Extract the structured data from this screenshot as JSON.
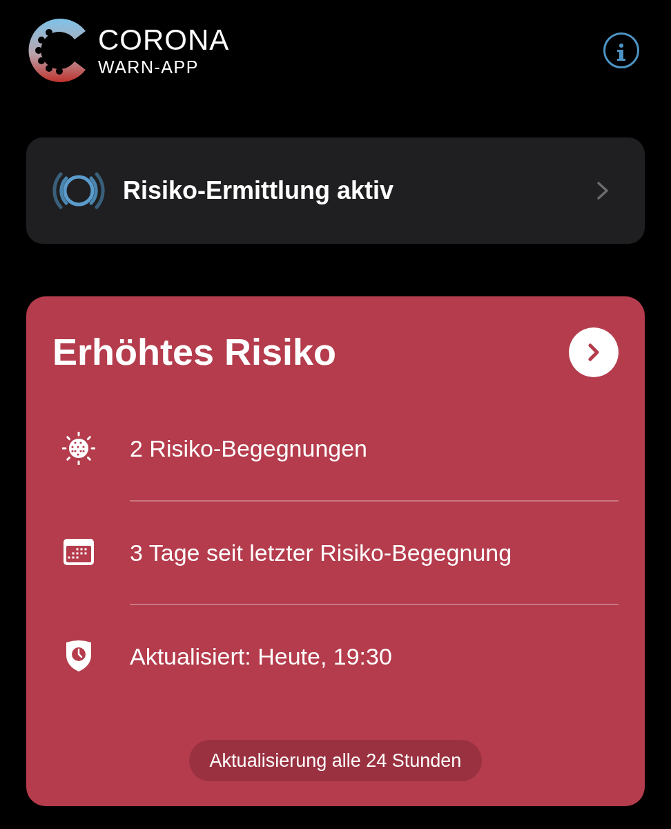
{
  "header": {
    "logo_title": "CORONA",
    "logo_subtitle": "WARN-APP"
  },
  "tracing": {
    "label": "Risiko-Ermittlung aktiv",
    "active": true
  },
  "risk_card": {
    "title": "Erhöhtes Risiko",
    "elevated": true,
    "items": [
      {
        "kind": "encounters",
        "text": "2 Risiko-Begegnungen"
      },
      {
        "kind": "calendar",
        "text": "3 Tage seit letzter Risiko-Begegnung"
      },
      {
        "kind": "updated",
        "text": "Aktualisiert: Heute, 19:30"
      }
    ],
    "update_note": "Aktualisierung alle 24 Stunden"
  }
}
